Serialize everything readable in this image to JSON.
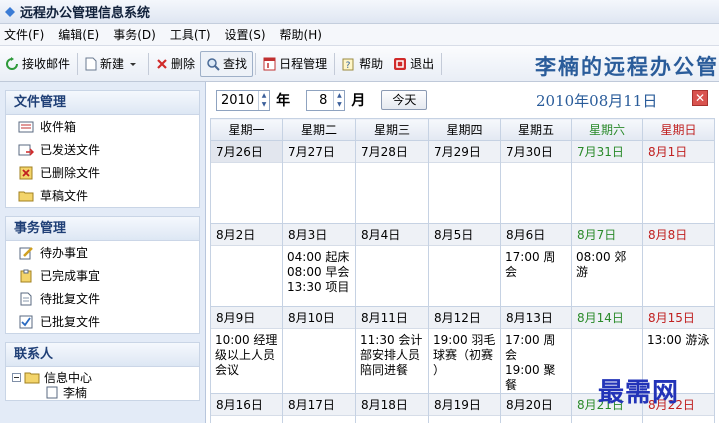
{
  "window": {
    "title": "远程办公管理信息系统"
  },
  "menu": [
    "文件(F)",
    "编辑(E)",
    "事务(D)",
    "工具(T)",
    "设置(S)",
    "帮助(H)"
  ],
  "toolbar": {
    "receive": "接收邮件",
    "new": "新建",
    "delete": "删除",
    "find": "查找",
    "schedule": "日程管理",
    "help": "帮助",
    "exit": "退出",
    "brand": "李楠的远程办公管"
  },
  "sidebar": {
    "file_mgmt": {
      "title": "文件管理",
      "items": [
        "收件箱",
        "已发送文件",
        "已删除文件",
        "草稿文件"
      ]
    },
    "task_mgmt": {
      "title": "事务管理",
      "items": [
        "待办事宜",
        "已完成事宜",
        "待批复文件",
        "已批复文件"
      ]
    },
    "contacts": {
      "title": "联系人",
      "root": "信息中心",
      "person": "李楠"
    }
  },
  "datebar": {
    "year": "2010",
    "year_unit": "年",
    "month": "8",
    "month_unit": "月",
    "today_label": "今天",
    "current_date": "2010年08月11日",
    "close": "✕"
  },
  "calendar": {
    "weekdays": [
      "星期一",
      "星期二",
      "星期三",
      "星期四",
      "星期五",
      "星期六",
      "星期日"
    ],
    "weeks": [
      {
        "days": [
          {
            "label": "7月26日",
            "events": []
          },
          {
            "label": "7月27日",
            "events": []
          },
          {
            "label": "7月28日",
            "events": []
          },
          {
            "label": "7月29日",
            "events": []
          },
          {
            "label": "7月30日",
            "events": []
          },
          {
            "label": "7月31日",
            "events": []
          },
          {
            "label": "8月1日",
            "events": []
          }
        ]
      },
      {
        "days": [
          {
            "label": "8月2日",
            "events": []
          },
          {
            "label": "8月3日",
            "events": [
              "04:00 起床",
              "08:00 早会",
              "13:30 项目"
            ]
          },
          {
            "label": "8月4日",
            "events": []
          },
          {
            "label": "8月5日",
            "events": []
          },
          {
            "label": "8月6日",
            "events": [
              "17:00 周会"
            ]
          },
          {
            "label": "8月7日",
            "events": [
              "08:00 郊游"
            ]
          },
          {
            "label": "8月8日",
            "events": []
          }
        ]
      },
      {
        "days": [
          {
            "label": "8月9日",
            "events": [
              "10:00 经理",
              "级以上人员",
              "会议"
            ]
          },
          {
            "label": "8月10日",
            "events": []
          },
          {
            "label": "8月11日",
            "events": [
              "11:30 会计",
              "部安排人员",
              "陪同进餐"
            ]
          },
          {
            "label": "8月12日",
            "events": [
              "19:00 羽毛",
              "球赛（初赛",
              "）"
            ]
          },
          {
            "label": "8月13日",
            "events": [
              "17:00 周会",
              "19:00 聚餐"
            ]
          },
          {
            "label": "8月14日",
            "events": []
          },
          {
            "label": "8月15日",
            "events": [
              "13:00 游泳"
            ]
          }
        ]
      },
      {
        "days": [
          {
            "label": "8月16日",
            "events": []
          },
          {
            "label": "8月17日",
            "events": []
          },
          {
            "label": "8月18日",
            "events": []
          },
          {
            "label": "8月19日",
            "events": []
          },
          {
            "label": "8月20日",
            "events": []
          },
          {
            "label": "8月21日",
            "events": []
          },
          {
            "label": "8月22日",
            "events": []
          }
        ]
      }
    ]
  },
  "watermark": "最需网"
}
